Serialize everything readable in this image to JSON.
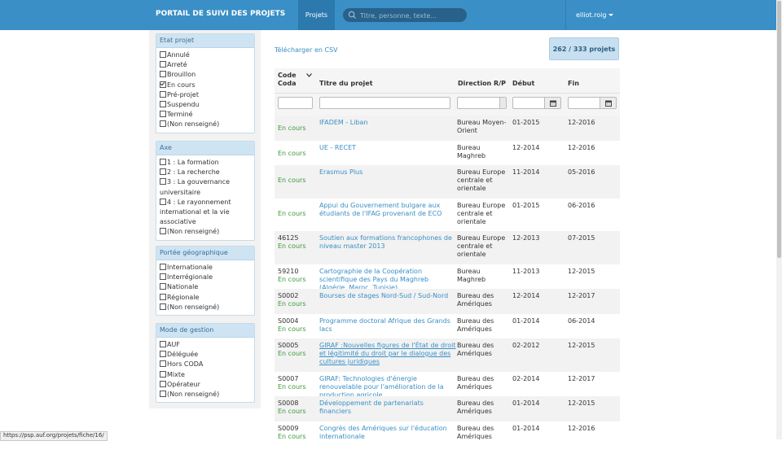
{
  "navbar": {
    "brand": "PORTAIL DE SUIVI DES PROJETS",
    "projets_label": "Projets",
    "search_placeholder": "Titre, personne, texte...",
    "user": "elliot.roig"
  },
  "sidebar": {
    "etat": {
      "title": "Etat projet",
      "items": [
        {
          "label": "Annulé",
          "checked": false
        },
        {
          "label": "Arreté",
          "checked": false
        },
        {
          "label": "Brouillon",
          "checked": false
        },
        {
          "label": "En cours",
          "checked": true
        },
        {
          "label": "Pré-projet",
          "checked": false
        },
        {
          "label": "Suspendu",
          "checked": false
        },
        {
          "label": "Terminé",
          "checked": false
        },
        {
          "label": "(Non renseigné)",
          "checked": false
        }
      ]
    },
    "axe": {
      "title": "Axe",
      "items": [
        {
          "label": "1 : La formation",
          "checked": false
        },
        {
          "label": "2 : La recherche",
          "checked": false
        },
        {
          "label": "3 : La gouvernance universitaire",
          "checked": false
        },
        {
          "label": "4 : Le rayonnement international et la vie associative",
          "checked": false
        },
        {
          "label": "(Non renseigné)",
          "checked": false
        }
      ]
    },
    "portee": {
      "title": "Portée géographique",
      "items": [
        {
          "label": "Internationale",
          "checked": false
        },
        {
          "label": "Interrégionale",
          "checked": false
        },
        {
          "label": "Nationale",
          "checked": false
        },
        {
          "label": "Régionale",
          "checked": false
        },
        {
          "label": "(Non renseigné)",
          "checked": false
        }
      ]
    },
    "mode": {
      "title": "Mode de gestion",
      "items": [
        {
          "label": "AUF",
          "checked": false
        },
        {
          "label": "Déléguée",
          "checked": false
        },
        {
          "label": "Hors CODA",
          "checked": false
        },
        {
          "label": "Mixte",
          "checked": false
        },
        {
          "label": "Opérateur",
          "checked": false
        },
        {
          "label": "(Non renseigné)",
          "checked": false
        }
      ]
    }
  },
  "main": {
    "csv_label": "Télécharger en CSV",
    "count_label": "262  / 333 projets",
    "headers": {
      "code": "Code Coda",
      "titre": "Titre du projet",
      "direction": "Direction R/P",
      "debut": "Début",
      "fin": "Fin"
    },
    "rows": [
      {
        "code": "",
        "status": "En cours",
        "title": "IFADEM - Liban",
        "direction": "Bureau Moyen-Orient",
        "debut": "01-2015",
        "fin": "12-2016"
      },
      {
        "code": "",
        "status": "En cours",
        "title": "UE - RECET",
        "direction": "Bureau Maghreb",
        "debut": "12-2014",
        "fin": "12-2016"
      },
      {
        "code": "",
        "status": "En cours",
        "title": "Erasmus Plus",
        "direction": "Bureau Europe centrale et orientale",
        "debut": "11-2014",
        "fin": "05-2016"
      },
      {
        "code": "",
        "status": "En cours",
        "title": "Appui du Gouvernement bulgare aux étudiants de l'IFAG provenant de ECO",
        "direction": "Bureau Europe centrale et orientale",
        "debut": "01-2015",
        "fin": "06-2016"
      },
      {
        "code": "46125",
        "status": "En cours",
        "title": "Soutien aux formations francophones de niveau master 2013",
        "direction": "Bureau Europe centrale et orientale",
        "debut": "12-2013",
        "fin": "07-2015"
      },
      {
        "code": "59210",
        "status": "En cours",
        "title": "Cartographie de la Coopération scientifique des Pays du Maghreb (Algérie, Maroc, Tunisie)",
        "direction": "Bureau Maghreb",
        "debut": "11-2013",
        "fin": "12-2015"
      },
      {
        "code": "S0002",
        "status": "En cours",
        "title": "Bourses de stages Nord-Sud / Sud-Nord",
        "direction": "Bureau des Amériques",
        "debut": "12-2014",
        "fin": "12-2017"
      },
      {
        "code": "S0004",
        "status": "En cours",
        "title": "Programme doctoral Afrique des Grands lacs",
        "direction": "Bureau des Amériques",
        "debut": "01-2014",
        "fin": "06-2014"
      },
      {
        "code": "S0005",
        "status": "En cours",
        "title": "GIRAF :Nouvelles figures de l'État de droit et légitimité du droit par le dialogue des cultures juridiques",
        "direction": "Bureau des Amériques",
        "debut": "02-2012",
        "fin": "12-2015"
      },
      {
        "code": "S0007",
        "status": "En cours",
        "title": "GIRAF: Technologies d'énergie renouvelable pour l'amélioration de la production agricole",
        "direction": "Bureau des Amériques",
        "debut": "02-2014",
        "fin": "12-2017"
      },
      {
        "code": "S0008",
        "status": "En cours",
        "title": "Développement de partenariats financiers",
        "direction": "Bureau des Amériques",
        "debut": "01-2014",
        "fin": "12-2015"
      },
      {
        "code": "S0009",
        "status": "En cours",
        "title": "Congrès des Amériques sur l'éducation internationale",
        "direction": "Bureau des Amériques",
        "debut": "01-2014",
        "fin": "12-2016"
      }
    ]
  },
  "statusbar": "https://psp.auf.org/projets/fiche/16/"
}
